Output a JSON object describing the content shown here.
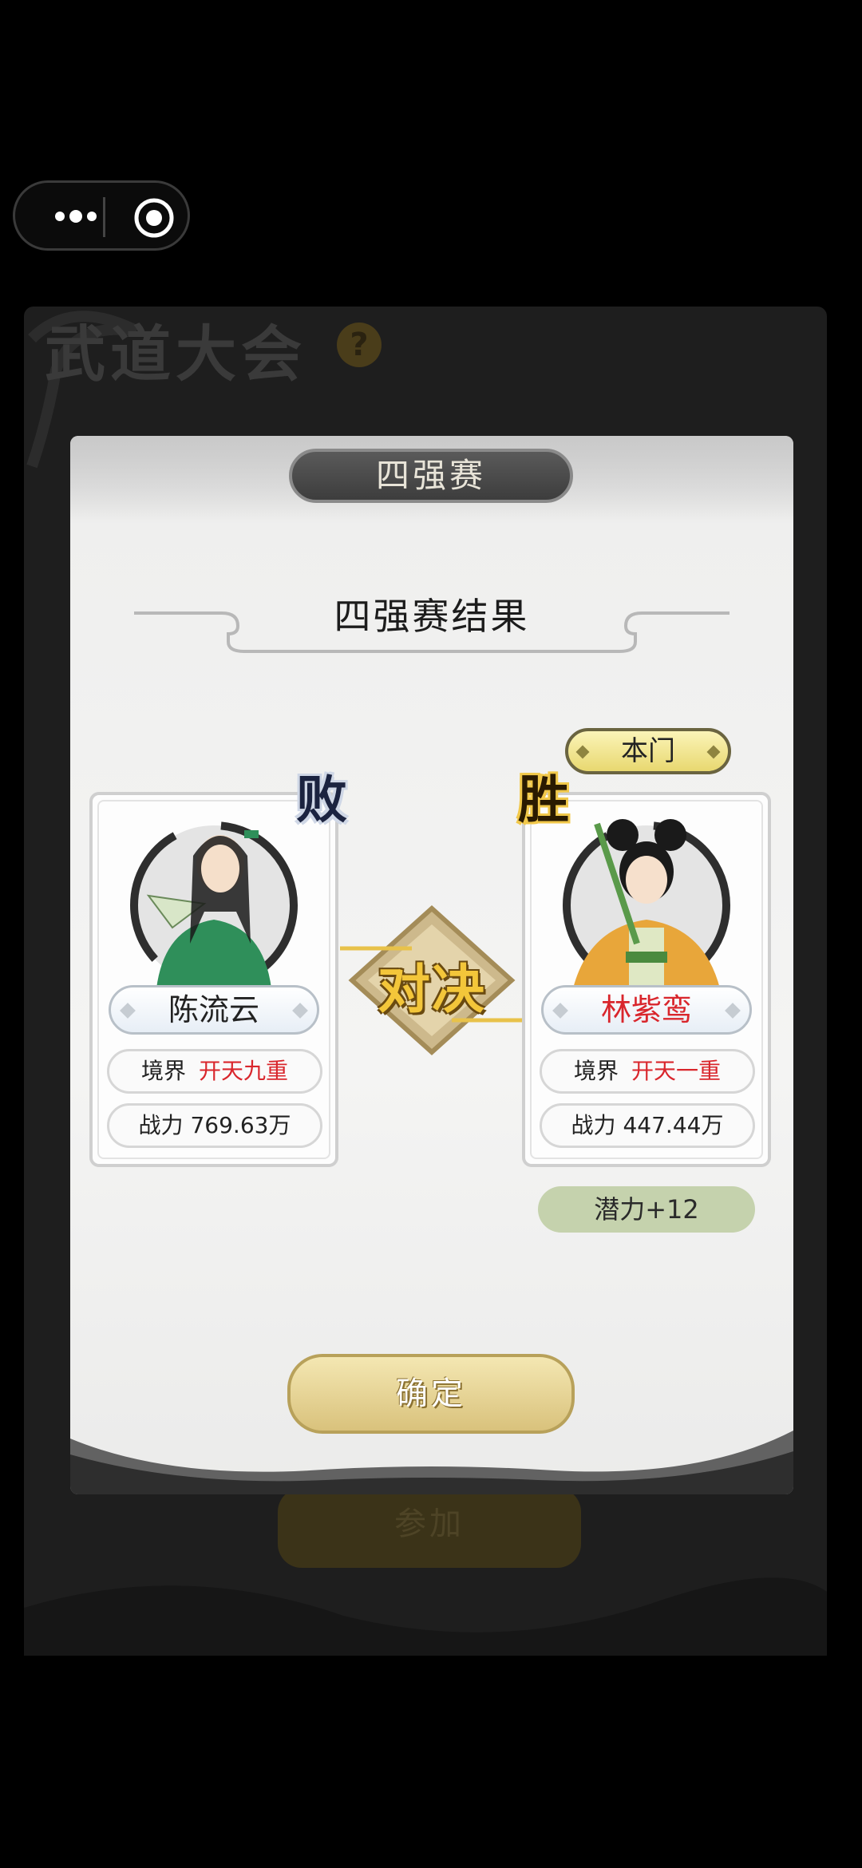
{
  "mini_program_capsule": {
    "menu_icon": "more-dots-icon",
    "close_icon": "target-icon"
  },
  "background_panel": {
    "title": "武道大会",
    "help_icon": "?",
    "join_label": "参加"
  },
  "modal": {
    "stage_tab": "四强赛",
    "result_title": "四强赛结果",
    "versus_label": "对决",
    "left_player": {
      "result_badge": "败",
      "name": "陈流云",
      "realm_label": "境界",
      "realm_value": "开天九重",
      "power_label": "战力",
      "power_value": "769.63万"
    },
    "right_player": {
      "sect_tag": "本门",
      "result_badge": "胜",
      "name": "林紫鸾",
      "realm_label": "境界",
      "realm_value": "开天一重",
      "power_label": "战力",
      "power_value": "447.44万",
      "potential": "潜力+12"
    },
    "confirm_label": "确定"
  },
  "colors": {
    "highlight_red": "#d9262c",
    "gold": "#f3c63a",
    "potential_green": "#c5d2ad"
  }
}
